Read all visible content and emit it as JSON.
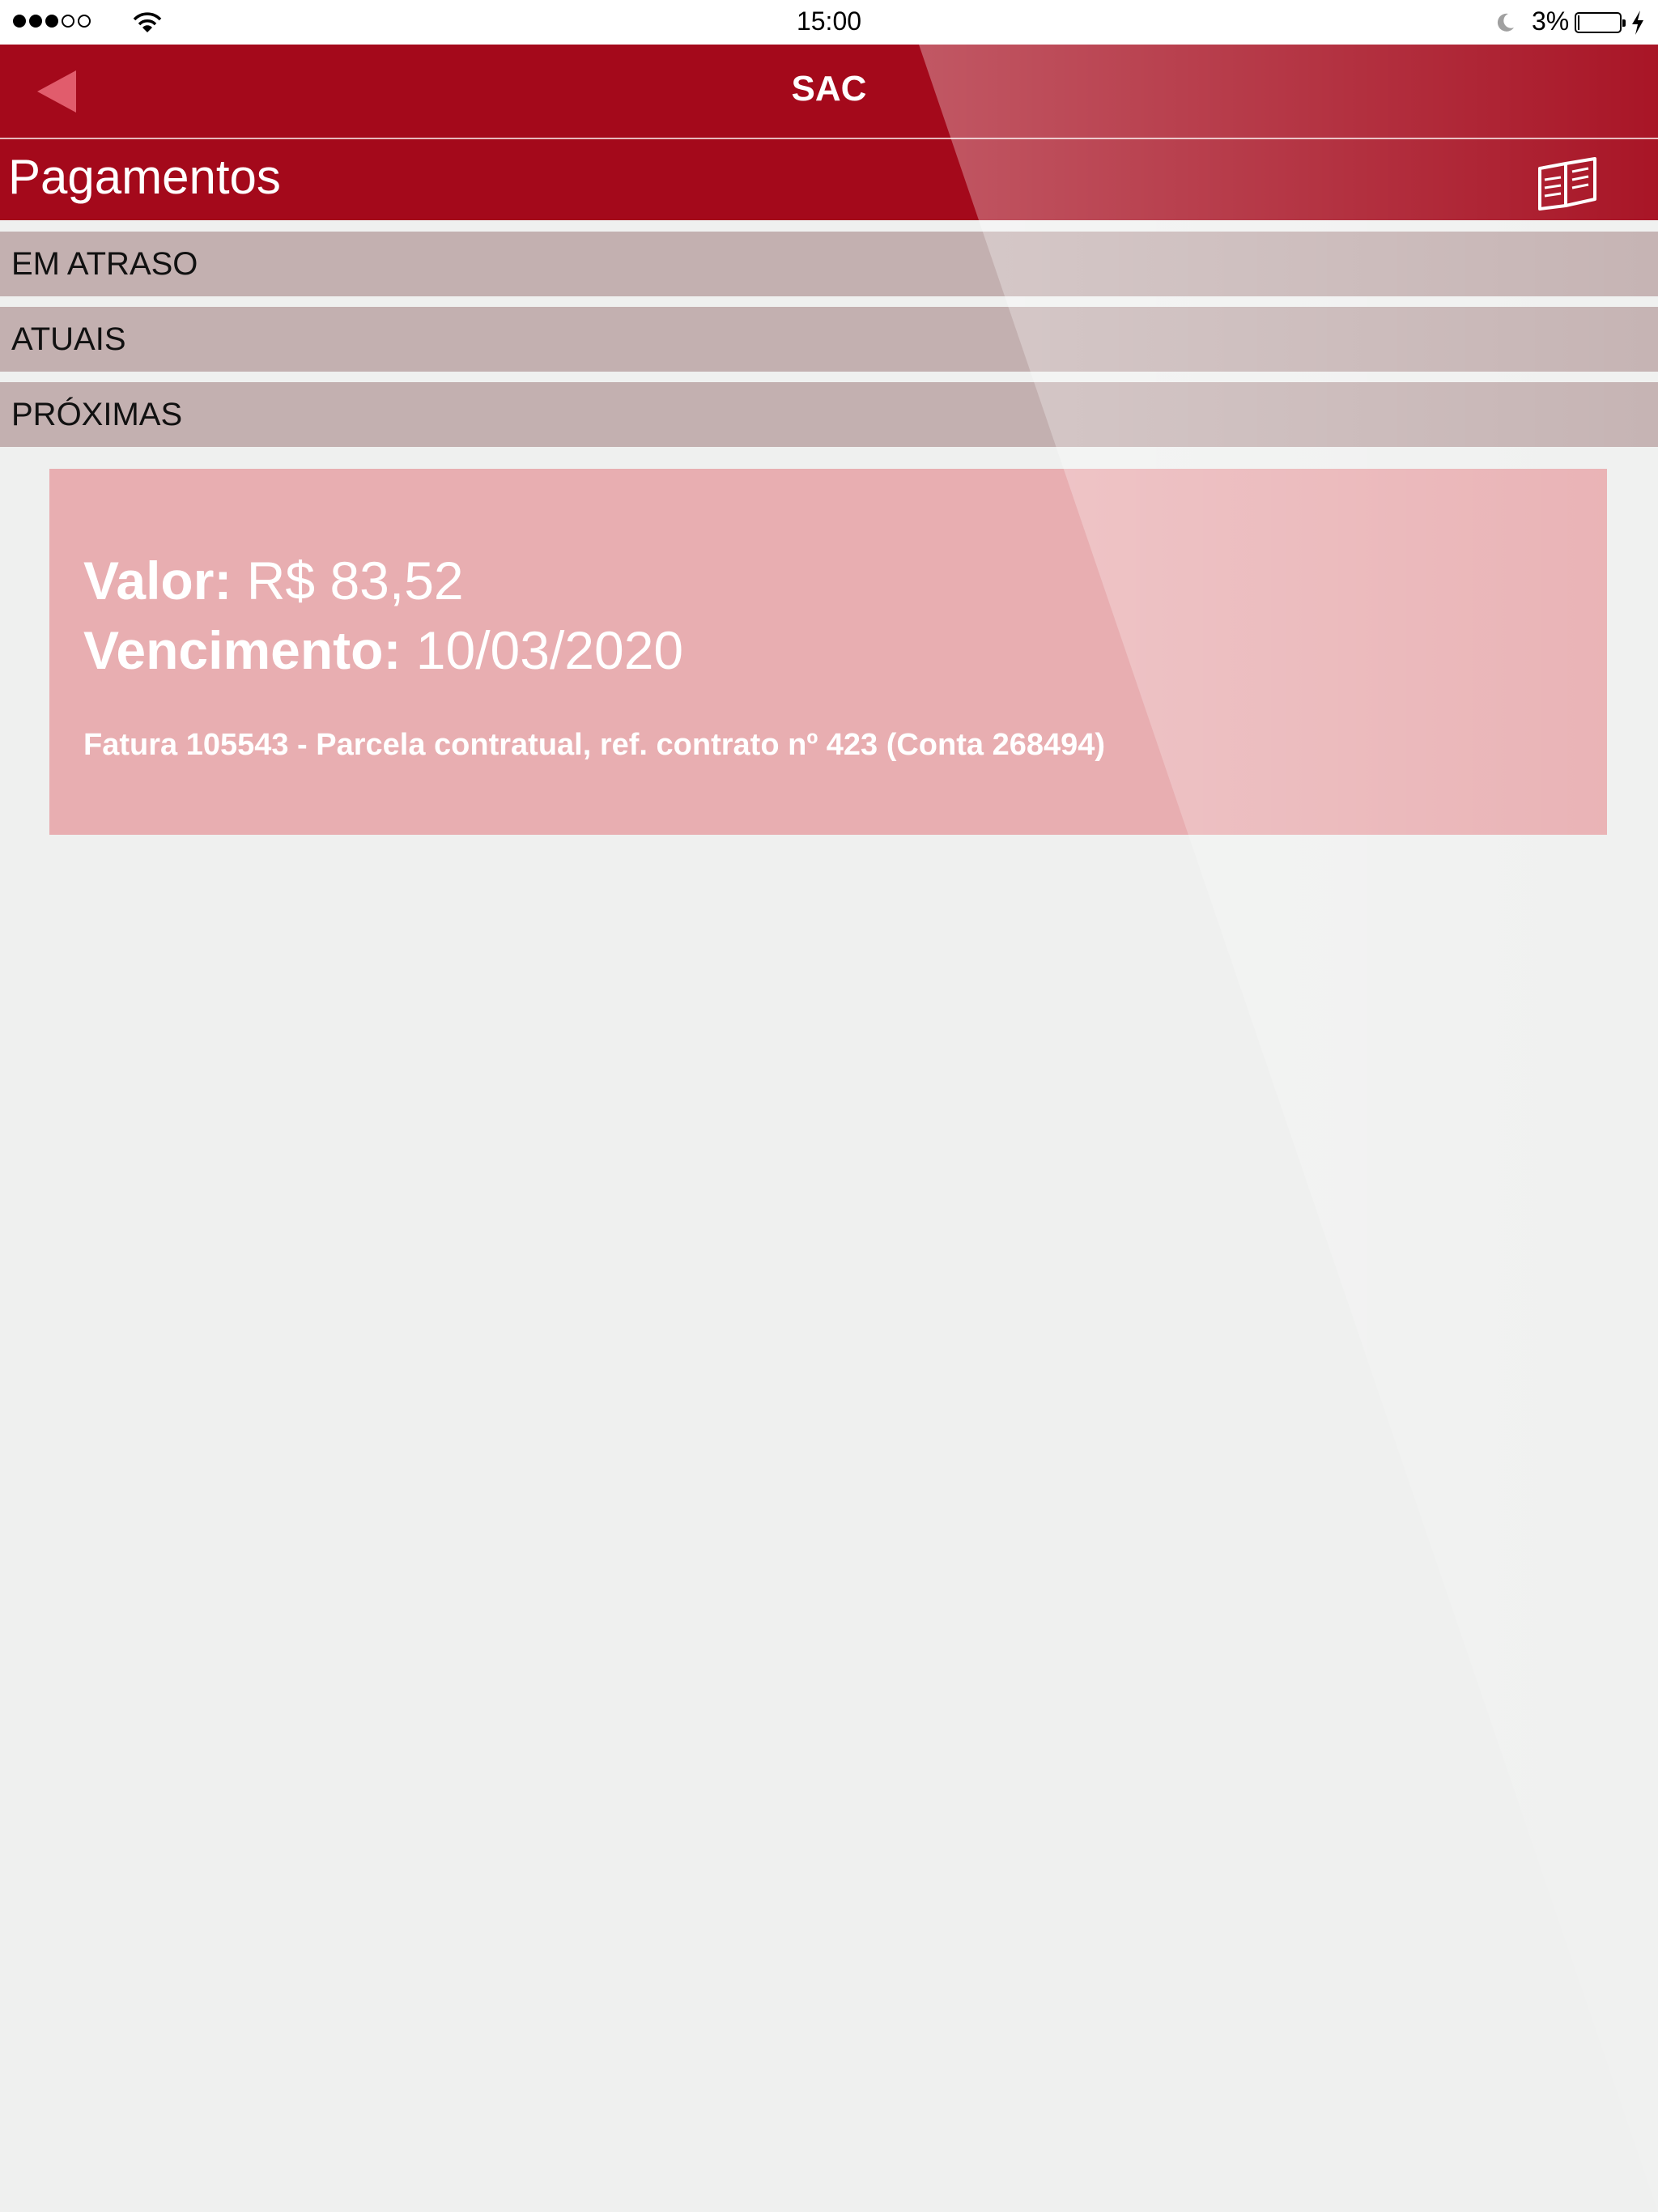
{
  "status_bar": {
    "time": "15:00",
    "battery_percent": "3%",
    "signal_bars_filled": 3,
    "signal_bars_total": 5,
    "icons": [
      "signal-dots-icon",
      "wifi-icon",
      "moon-icon",
      "battery-icon",
      "charging-bolt-icon"
    ]
  },
  "nav": {
    "title": "SAC",
    "back_icon": "back-arrow-icon"
  },
  "section": {
    "title": "Pagamentos",
    "icon": "book-icon"
  },
  "tabs": [
    {
      "label": "EM ATRASO"
    },
    {
      "label": "ATUAIS"
    },
    {
      "label": "PRÓXIMAS"
    }
  ],
  "payment": {
    "valor_label": "Valor:",
    "valor": "R$ 83,52",
    "vencimento_label": "Vencimento:",
    "vencimento": "10/03/2020",
    "description": "Fatura 105543 - Parcela contratual, ref. contrato nº 423 (Conta 268494)"
  },
  "colors": {
    "brand_red": "#a4091b",
    "tab_bg": "#c3b0b0",
    "card_bg": "#e8aeb1",
    "page_bg": "#eff0ef"
  }
}
